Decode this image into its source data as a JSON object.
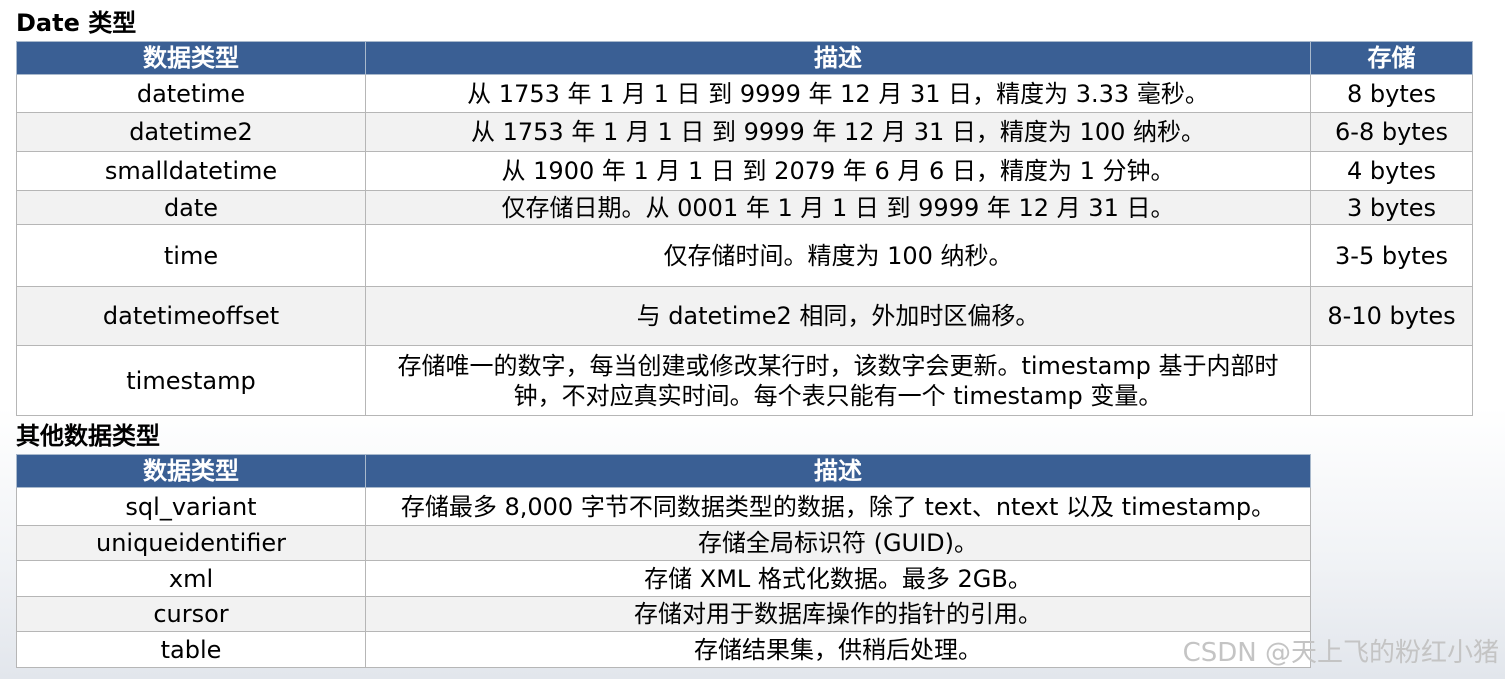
{
  "section1": {
    "title": "Date 类型",
    "headers": [
      "数据类型",
      "描述",
      "存储"
    ],
    "rows": [
      {
        "type": "datetime",
        "desc": "从 1753 年 1 月 1 日 到 9999 年 12 月 31 日，精度为 3.33 毫秒。",
        "storage": "8 bytes"
      },
      {
        "type": "datetime2",
        "desc": "从 1753 年 1 月 1 日 到 9999 年 12 月 31 日，精度为 100 纳秒。",
        "storage": "6-8 bytes"
      },
      {
        "type": "smalldatetime",
        "desc": "从 1900 年 1 月 1 日 到 2079 年 6 月 6 日，精度为 1 分钟。",
        "storage": "4 bytes"
      },
      {
        "type": "date",
        "desc": "仅存储日期。从 0001 年 1 月 1 日 到 9999 年 12 月 31 日。",
        "storage": "3 bytes"
      },
      {
        "type": "time",
        "desc": "仅存储时间。精度为 100 纳秒。",
        "storage": "3-5 bytes"
      },
      {
        "type": "datetimeoffset",
        "desc": "与 datetime2 相同，外加时区偏移。",
        "storage": "8-10 bytes"
      },
      {
        "type": "timestamp",
        "desc": "存储唯一的数字，每当创建或修改某行时，该数字会更新。timestamp 基于内部时钟，不对应真实时间。每个表只能有一个 timestamp 变量。",
        "storage": ""
      }
    ]
  },
  "section2": {
    "title": "其他数据类型",
    "headers": [
      "数据类型",
      "描述"
    ],
    "rows": [
      {
        "type": "sql_variant",
        "desc": "存储最多 8,000 字节不同数据类型的数据，除了 text、ntext 以及 timestamp。"
      },
      {
        "type": "uniqueidentifier",
        "desc": "存储全局标识符 (GUID)。"
      },
      {
        "type": "xml",
        "desc": "存储 XML 格式化数据。最多 2GB。"
      },
      {
        "type": "cursor",
        "desc": "存储对用于数据库操作的指针的引用。"
      },
      {
        "type": "table",
        "desc": "存储结果集，供稍后处理。"
      }
    ]
  },
  "watermark": "CSDN @天上飞的粉红小猪"
}
